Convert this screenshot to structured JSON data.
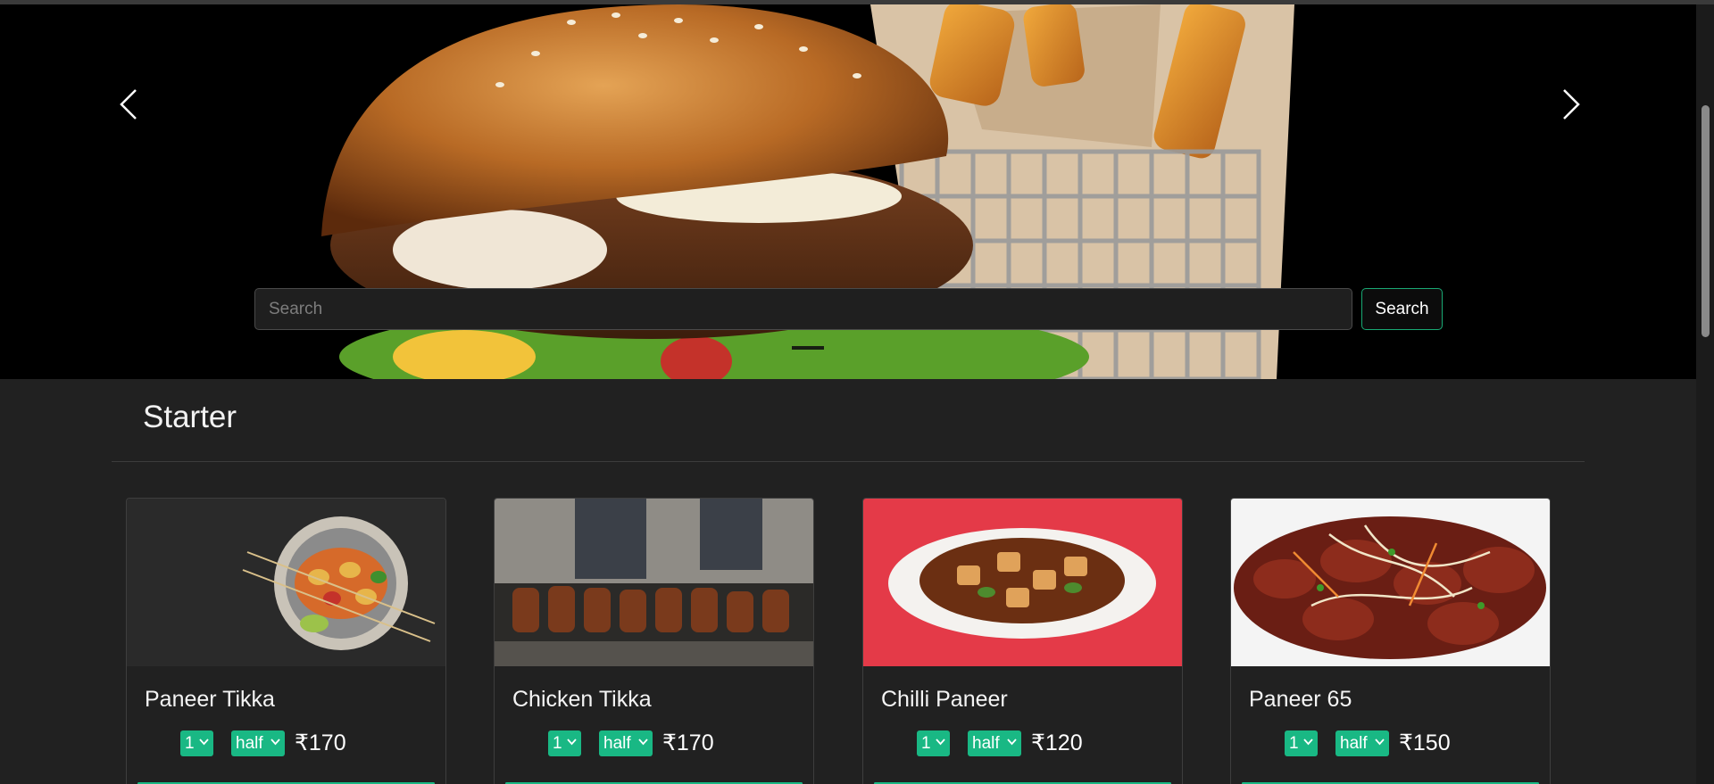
{
  "hero": {
    "search_placeholder": "Search",
    "search_button": "Search",
    "prev_icon": "chevron-left-icon",
    "next_icon": "chevron-right-icon",
    "image": "burger-and-fries-photo"
  },
  "section": {
    "title": "Starter"
  },
  "cards": [
    {
      "title": "Paneer Tikka",
      "qty": "1",
      "size": "half",
      "price": "₹170",
      "image": "paneer-tikka-photo"
    },
    {
      "title": "Chicken Tikka",
      "qty": "1",
      "size": "half",
      "price": "₹170",
      "image": "chicken-tikka-photo"
    },
    {
      "title": "Chilli Paneer",
      "qty": "1",
      "size": "half",
      "price": "₹120",
      "image": "chilli-paneer-photo"
    },
    {
      "title": "Paneer 65",
      "qty": "1",
      "size": "half",
      "price": "₹150",
      "image": "paneer-65-photo"
    }
  ],
  "colors": {
    "accent": "#19b884",
    "background": "#212121"
  }
}
